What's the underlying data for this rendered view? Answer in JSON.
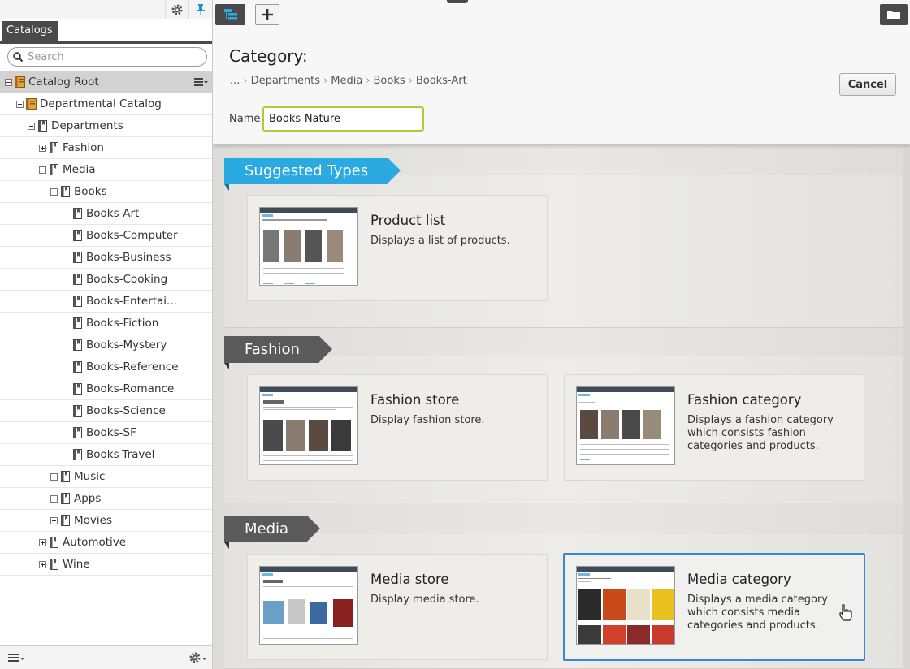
{
  "sidebar": {
    "tab_label": "Catalogs",
    "search_placeholder": "Search",
    "tree": [
      {
        "label": "Catalog Root",
        "level": 0,
        "toggle": "minus",
        "icon": "catalog-root-icon",
        "selected": true
      },
      {
        "label": "Departmental Catalog",
        "level": 1,
        "toggle": "minus",
        "icon": "catalog-icon"
      },
      {
        "label": "Departments",
        "level": 2,
        "toggle": "minus",
        "icon": "category-icon"
      },
      {
        "label": "Fashion",
        "level": 3,
        "toggle": "plus",
        "icon": "category-icon"
      },
      {
        "label": "Media",
        "level": 3,
        "toggle": "minus",
        "icon": "category-icon"
      },
      {
        "label": "Books",
        "level": 4,
        "toggle": "minus",
        "icon": "category-icon"
      },
      {
        "label": "Books-Art",
        "level": 5,
        "toggle": "none",
        "icon": "category-icon"
      },
      {
        "label": "Books-Computer",
        "level": 5,
        "toggle": "none",
        "icon": "category-icon"
      },
      {
        "label": "Books-Business",
        "level": 5,
        "toggle": "none",
        "icon": "category-icon"
      },
      {
        "label": "Books-Cooking",
        "level": 5,
        "toggle": "none",
        "icon": "category-icon"
      },
      {
        "label": "Books-Entertai...",
        "level": 5,
        "toggle": "none",
        "icon": "category-icon"
      },
      {
        "label": "Books-Fiction",
        "level": 5,
        "toggle": "none",
        "icon": "category-icon"
      },
      {
        "label": "Books-Mystery",
        "level": 5,
        "toggle": "none",
        "icon": "category-icon"
      },
      {
        "label": "Books-Reference",
        "level": 5,
        "toggle": "none",
        "icon": "category-icon"
      },
      {
        "label": "Books-Romance",
        "level": 5,
        "toggle": "none",
        "icon": "category-icon"
      },
      {
        "label": "Books-Science",
        "level": 5,
        "toggle": "none",
        "icon": "category-icon"
      },
      {
        "label": "Books-SF",
        "level": 5,
        "toggle": "none",
        "icon": "category-icon"
      },
      {
        "label": "Books-Travel",
        "level": 5,
        "toggle": "none",
        "icon": "category-icon"
      },
      {
        "label": "Music",
        "level": 4,
        "toggle": "plus",
        "icon": "category-icon"
      },
      {
        "label": "Apps",
        "level": 4,
        "toggle": "plus",
        "icon": "category-icon"
      },
      {
        "label": "Movies",
        "level": 4,
        "toggle": "plus",
        "icon": "category-icon"
      },
      {
        "label": "Automotive",
        "level": 3,
        "toggle": "plus",
        "icon": "category-icon"
      },
      {
        "label": "Wine",
        "level": 3,
        "toggle": "plus",
        "icon": "category-icon"
      }
    ]
  },
  "main": {
    "title": "Category:",
    "breadcrumb": [
      "...",
      "Departments",
      "Media",
      "Books",
      "Books-Art"
    ],
    "cancel_label": "Cancel",
    "name_label": "Name",
    "name_value": "Books-Nature",
    "sections": [
      {
        "label": "Suggested Types",
        "style": "blue",
        "cards": [
          {
            "title": "Product list",
            "desc": "Displays a list of products.",
            "thumb_title": "You Are Shopping in the Fashion Department"
          }
        ]
      },
      {
        "label": "Fashion",
        "style": "dark",
        "cards": [
          {
            "title": "Fashion store",
            "desc": "Display fashion store.",
            "thumb_title": "Fashion"
          },
          {
            "title": "Fashion category",
            "desc": "Displays a fashion category which consists fashion categories and products.",
            "thumb_title": "Shopping Fashion Store"
          }
        ]
      },
      {
        "label": "Media",
        "style": "dark",
        "cards": [
          {
            "title": "Media store",
            "desc": "Display media store.",
            "thumb_title": "Media"
          },
          {
            "title": "Media category",
            "desc": "Displays a media category which consists media categories and products.",
            "thumb_title": "Shopping Media Store",
            "selected": true
          }
        ]
      }
    ]
  },
  "colors": {
    "accent_blue": "#2aaae1",
    "ribbon_dark": "#5a5a5a",
    "selected_border": "#3a86d4",
    "input_focus": "#b5c83a"
  }
}
